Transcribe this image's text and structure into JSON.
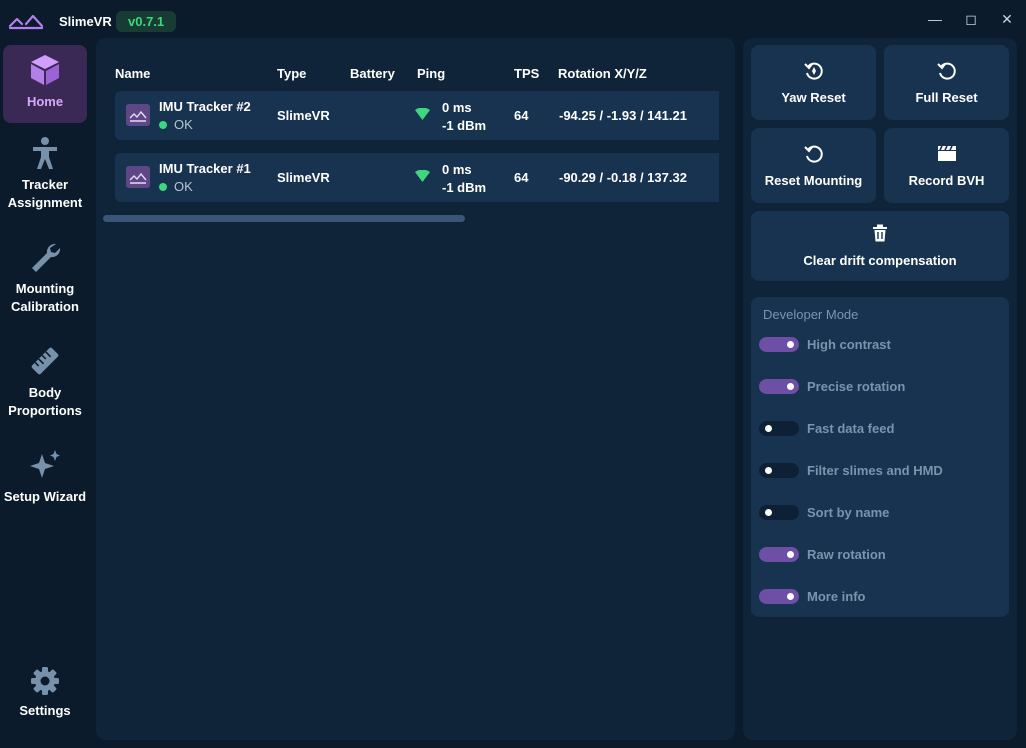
{
  "app": {
    "name": "SlimeVR",
    "version": "v0.7.1"
  },
  "window_controls": {
    "minimize": "—",
    "maximize": "◻",
    "close": "✕"
  },
  "sidebar": {
    "items": [
      {
        "label": "Home",
        "icon": "cube-icon",
        "active": true
      },
      {
        "label": "Tracker Assignment",
        "icon": "person-icon"
      },
      {
        "label": "Mounting Calibration",
        "icon": "wrench-icon"
      },
      {
        "label": "Body Proportions",
        "icon": "ruler-icon"
      },
      {
        "label": "Setup Wizard",
        "icon": "sparkles-icon"
      },
      {
        "label": "Settings",
        "icon": "gear-icon"
      }
    ]
  },
  "table": {
    "columns": [
      "Name",
      "Type",
      "Battery",
      "Ping",
      "TPS",
      "Rotation X/Y/Z"
    ],
    "rows": [
      {
        "name": "IMU Tracker #2",
        "status": "OK",
        "type": "SlimeVR",
        "ping": "0 ms",
        "signal": "-1 dBm",
        "tps": "64",
        "rotation": "-94.25 / -1.93 / 141.21"
      },
      {
        "name": "IMU Tracker #1",
        "status": "OK",
        "type": "SlimeVR",
        "ping": "0 ms",
        "signal": "-1 dBm",
        "tps": "64",
        "rotation": "-90.29 / -0.18 / 137.32"
      }
    ]
  },
  "actions": {
    "yaw_reset": "Yaw Reset",
    "full_reset": "Full Reset",
    "reset_mounting": "Reset Mounting",
    "record_bvh": "Record BVH",
    "clear_drift": "Clear drift compensation"
  },
  "developer_mode": {
    "title": "Developer Mode",
    "toggles": [
      {
        "label": "High contrast",
        "on": true
      },
      {
        "label": "Precise rotation",
        "on": true
      },
      {
        "label": "Fast data feed",
        "on": false
      },
      {
        "label": "Filter slimes and HMD",
        "on": false
      },
      {
        "label": "Sort by name",
        "on": false
      },
      {
        "label": "Raw rotation",
        "on": true
      },
      {
        "label": "More info",
        "on": true
      }
    ]
  },
  "colors": {
    "background": "#0b1b2b",
    "panel": "#0f2438",
    "card": "#183350",
    "accent": "#6d4fa6",
    "ok": "#3ed67e"
  }
}
